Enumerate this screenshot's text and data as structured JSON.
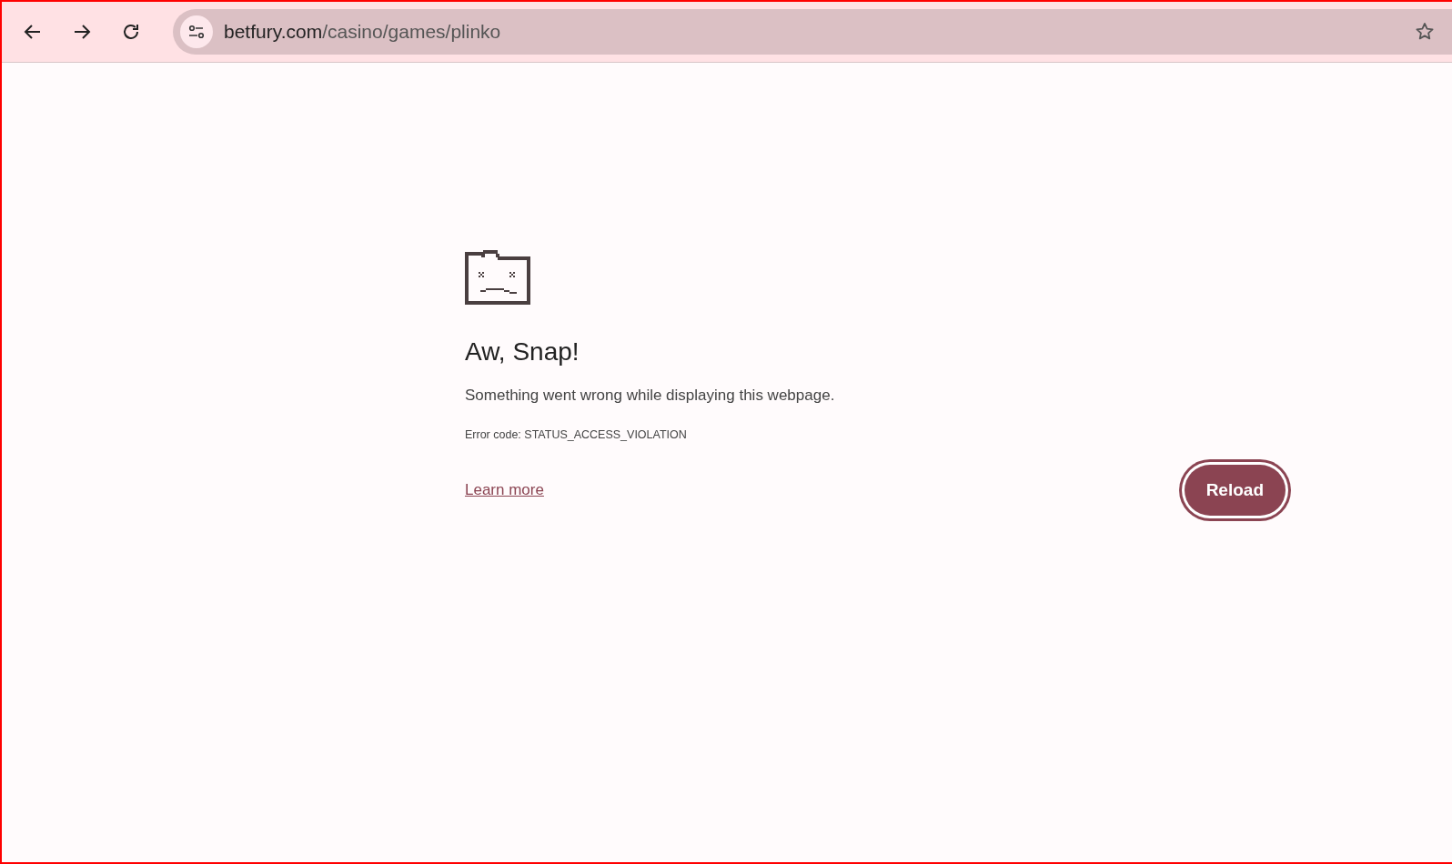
{
  "toolbar": {
    "url": {
      "host": "betfury.com",
      "path": "/casino/games/plinko"
    }
  },
  "error_page": {
    "title": "Aw, Snap!",
    "message": "Something went wrong while displaying this webpage.",
    "error_code": "Error code: STATUS_ACCESS_VIOLATION",
    "learn_more": "Learn more",
    "reload_button": {
      "label": "Reload",
      "focused": true
    }
  }
}
